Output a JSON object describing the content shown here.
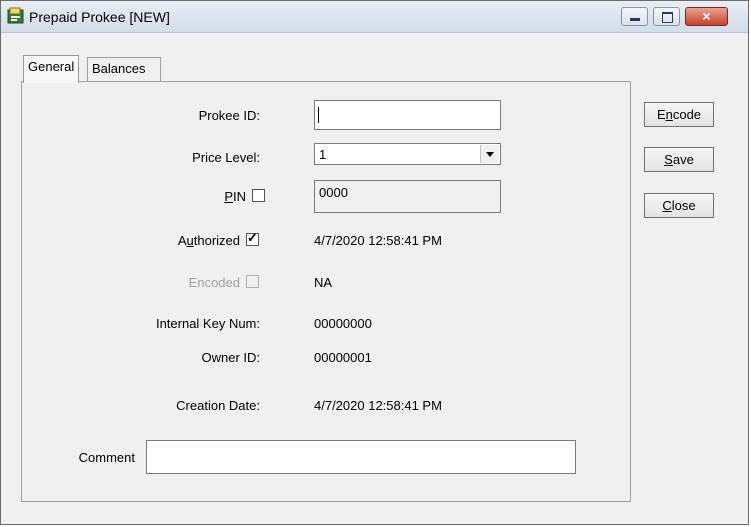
{
  "window": {
    "title": "Prepaid Prokee  [NEW]",
    "icon": "app-icon",
    "controls": {
      "minimize": "minimize-icon",
      "maximize": "maximize-icon",
      "close": "×"
    }
  },
  "tabs": [
    {
      "label": "General",
      "active": true
    },
    {
      "label": "Balances",
      "active": false
    }
  ],
  "form": {
    "prokee_id": {
      "label": "Prokee ID:",
      "value": ""
    },
    "price_level": {
      "label": "Price Level:",
      "value": "1"
    },
    "pin": {
      "label_prefix": "",
      "label_u": "P",
      "label_rest": "IN",
      "checked": false,
      "value": "0000"
    },
    "authorized": {
      "label_prefix": "A",
      "label_u": "u",
      "label_rest": "thorized",
      "checked": true,
      "check_glyph": "✓",
      "value": "4/7/2020 12:58:41 PM"
    },
    "encoded": {
      "label": "Encoded",
      "checked": false,
      "disabled": true,
      "value": "NA"
    },
    "internal_key_num": {
      "label": "Internal Key Num:",
      "value": "00000000"
    },
    "owner_id": {
      "label": "Owner ID:",
      "value": "00000001"
    },
    "creation_date": {
      "label": "Creation Date:",
      "value": "4/7/2020 12:58:41 PM"
    },
    "comment": {
      "label": "Comment",
      "value": ""
    }
  },
  "buttons": {
    "encode": {
      "pre": "E",
      "u": "n",
      "post": "code"
    },
    "save": {
      "pre": "",
      "u": "S",
      "post": "ave"
    },
    "close": {
      "pre": "",
      "u": "C",
      "post": "lose"
    }
  }
}
